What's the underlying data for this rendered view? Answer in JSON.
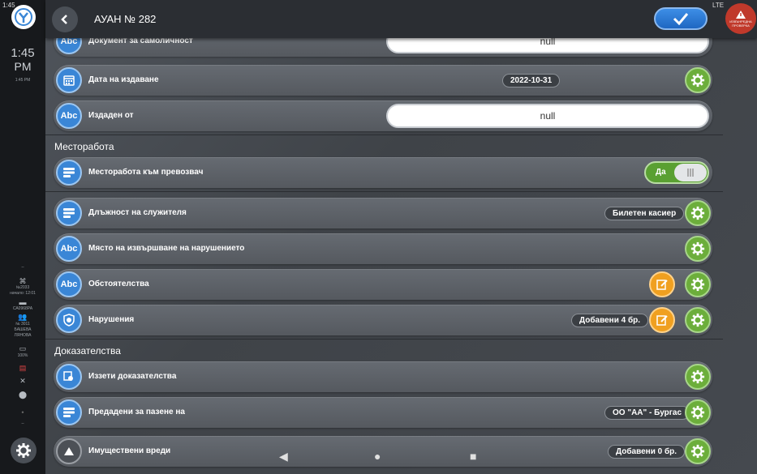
{
  "status_bar": {
    "time": "1:45",
    "network": "LTE"
  },
  "rail": {
    "clock_time": "1:45",
    "clock_ampm": "PM",
    "clock_small": "1:45 PM",
    "dash1": "--",
    "device_id": "№2033",
    "start_label": "начало: 12:01",
    "vehicle": "СА0968РА",
    "employee_no": "№ 3011",
    "employee_name1": "БАШЕВА",
    "employee_name2": "ЛЯНОВА",
    "battery": "100%",
    "dash2": "--"
  },
  "header": {
    "title": "АУАН № 282",
    "alert_text1": "ИЗВЪНРЕДНА",
    "alert_text2": "ПРОВЕРКА"
  },
  "rows": {
    "id_document": {
      "label": "Документ за самоличност",
      "value": "null"
    },
    "issue_date": {
      "label": "Дата на издаване",
      "value": "2022-10-31"
    },
    "issued_by": {
      "label": "Издаден от",
      "value": "null"
    },
    "workplace_section": "Месторабота",
    "workplace_carrier": {
      "label": "Месторабота към превозвач",
      "toggle": "Да"
    },
    "employee_position": {
      "label": "Длъжност на служителя",
      "value": "Билетен касиер"
    },
    "violation_place": {
      "label": "Място на извършване на нарушението"
    },
    "circumstances": {
      "label": "Обстоятелства"
    },
    "violations": {
      "label": "Нарушения",
      "value": "Добавени 4 бр."
    },
    "evidence_section": "Доказателства",
    "seized_evidence": {
      "label": "Иззети доказателства"
    },
    "handed_for_storage": {
      "label": "Предадени за пазене на",
      "value": "ОО \"АА\" - Бургас"
    },
    "property_damage": {
      "label": "Имуществени вреди",
      "value": "Добавени 0 бр."
    }
  },
  "colors": {
    "accent_blue": "#3a86d6",
    "gear_green": "#6cae3b",
    "edit_orange": "#f0a020",
    "alert_red": "#c0392b"
  },
  "icons": [
    "back-icon",
    "check-icon",
    "gear-icon",
    "calendar-icon",
    "abc-icon",
    "list-icon",
    "shield-icon",
    "edit-icon",
    "warning-icon"
  ]
}
